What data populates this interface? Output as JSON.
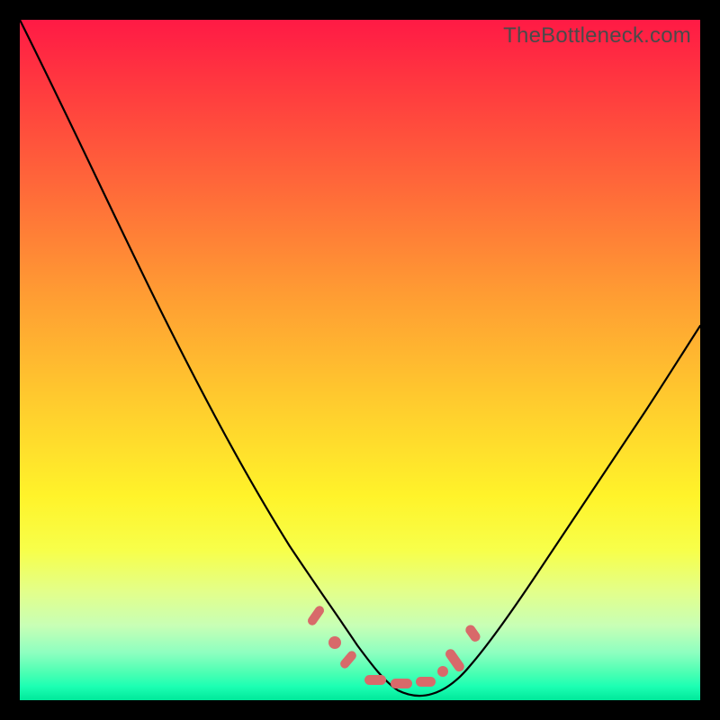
{
  "watermark": "TheBottleneck.com",
  "colors": {
    "background": "#000000",
    "gradient_top": "#ff1a45",
    "gradient_mid": "#fff32a",
    "gradient_bottom": "#00e89a",
    "curve": "#000000",
    "marker": "#d86a6a"
  },
  "chart_data": {
    "type": "line",
    "title": "",
    "xlabel": "",
    "ylabel": "",
    "xlim": [
      0,
      100
    ],
    "ylim": [
      0,
      100
    ],
    "x": [
      0,
      5,
      10,
      15,
      20,
      25,
      30,
      35,
      40,
      45,
      48,
      50,
      52,
      55,
      58,
      60,
      65,
      70,
      75,
      80,
      85,
      90,
      95,
      100
    ],
    "values": [
      100,
      88,
      76,
      64,
      53,
      42,
      32,
      23,
      15,
      8,
      4,
      2,
      1,
      0,
      0,
      1,
      4,
      9,
      15,
      22,
      29,
      36,
      43,
      50
    ],
    "note": "Values approximate the V-shaped bottleneck curve; y=0 is bottom (green), y=100 is top (red). Minimum near x≈55–58.",
    "markers_x": [
      43,
      46,
      48,
      50,
      52,
      55,
      58,
      61,
      64
    ],
    "markers_note": "Approximate x-positions of the pink marker beads near the curve bottom."
  }
}
